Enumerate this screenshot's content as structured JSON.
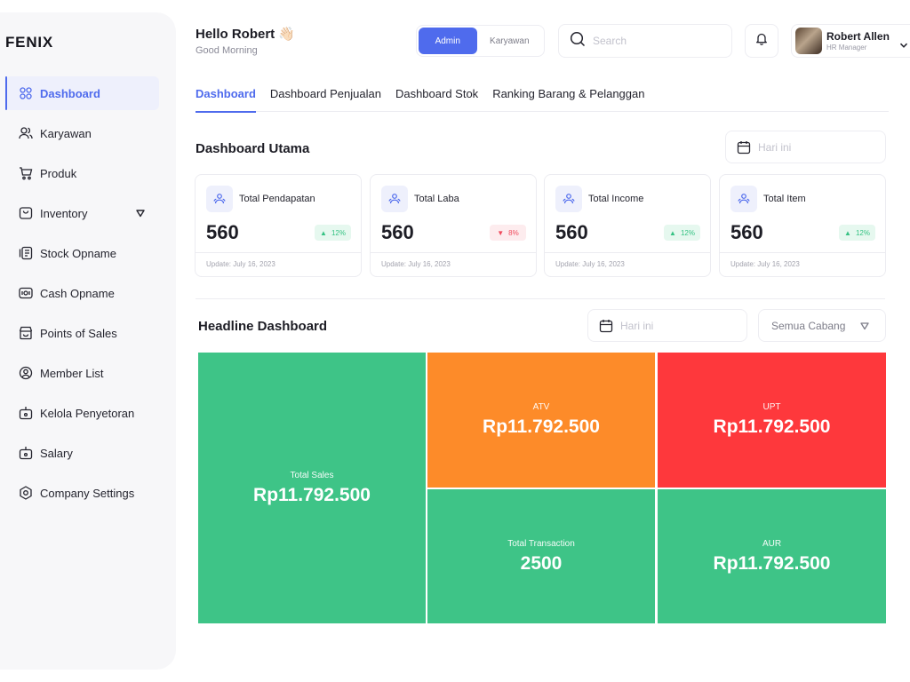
{
  "brand": "FENIX",
  "sidebar": {
    "items": [
      {
        "label": "Dashboard",
        "icon": "grid-icon"
      },
      {
        "label": "Karyawan",
        "icon": "users-icon"
      },
      {
        "label": "Produk",
        "icon": "cart-icon"
      },
      {
        "label": "Inventory",
        "icon": "box-icon"
      },
      {
        "label": "Stock Opname",
        "icon": "clipboard-icon"
      },
      {
        "label": "Cash Opname",
        "icon": "cash-icon"
      },
      {
        "label": "Points of Sales",
        "icon": "store-icon"
      },
      {
        "label": "Member List",
        "icon": "user-circle-icon"
      },
      {
        "label": "Kelola Penyetoran",
        "icon": "wallet-icon"
      },
      {
        "label": "Salary",
        "icon": "wallet-icon"
      },
      {
        "label": "Company Settings",
        "icon": "gear-icon"
      }
    ]
  },
  "header": {
    "greeting": "Hello Robert",
    "wave_emoji": "👋🏻",
    "subtitle": "Good Morning",
    "role_active": "Admin",
    "role_inactive": "Karyawan",
    "search_placeholder": "Search",
    "user_name": "Robert Allen",
    "user_role": "HR Manager"
  },
  "tabs": [
    "Dashboard",
    "Dashboard Penjualan",
    "Dashboard Stok",
    "Ranking Barang & Pelanggan"
  ],
  "section_main": {
    "title": "Dashboard Utama",
    "date_placeholder": "Hari ini"
  },
  "cards": [
    {
      "title": "Total Pendapatan",
      "value": "560",
      "badge": "12%",
      "trend": "up",
      "updated": "Update: July 16, 2023"
    },
    {
      "title": "Total Laba",
      "value": "560",
      "badge": "8%",
      "trend": "down",
      "updated": "Update: July 16, 2023"
    },
    {
      "title": "Total Income",
      "value": "560",
      "badge": "12%",
      "trend": "up",
      "updated": "Update: July 16, 2023"
    },
    {
      "title": "Total Item",
      "value": "560",
      "badge": "12%",
      "trend": "up",
      "updated": "Update: July 16, 2023"
    }
  ],
  "headline": {
    "title": "Headline Dashboard",
    "date_placeholder": "Hari ini",
    "branch_select": "Semua Cabang"
  },
  "tiles": [
    {
      "label": "Total Sales",
      "value": "Rp11.792.500",
      "color": "#3ec487"
    },
    {
      "label": "ATV",
      "value": "Rp11.792.500",
      "color": "#fd8b29"
    },
    {
      "label": "UPT",
      "value": "Rp11.792.500",
      "color": "#fe383c"
    },
    {
      "label": "Total Transaction",
      "value": "2500",
      "color": "#3ec487"
    },
    {
      "label": "AUR",
      "value": "Rp11.792.500",
      "color": "#3ec487"
    }
  ],
  "colors": {
    "accent": "#4f6bed",
    "up": "#35c283",
    "down": "#f04a5c"
  }
}
